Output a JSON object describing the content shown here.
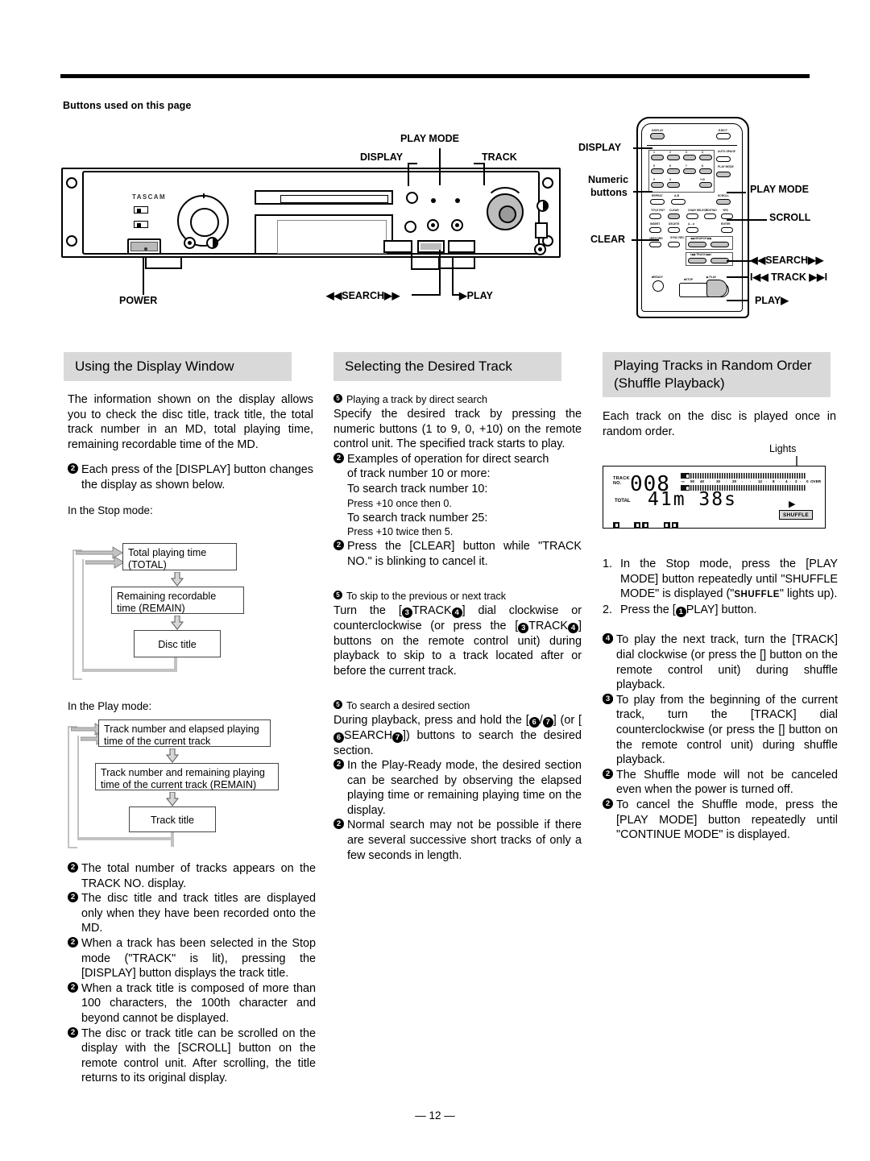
{
  "header": {
    "buttons_used": "Buttons used on this page"
  },
  "deck_figure": {
    "brand": "TASCAM",
    "callouts": {
      "play_mode": "PLAY MODE",
      "display": "DISPLAY",
      "track": "TRACK",
      "power": "POWER",
      "search": "◀◀SEARCH▶▶",
      "play": "▶PLAY"
    }
  },
  "remote_figure": {
    "callouts": {
      "display": "DISPLAY",
      "numeric_buttons_line1": "Numeric",
      "numeric_buttons_line2": "buttons",
      "clear": "CLEAR",
      "play_mode": "PLAY MODE",
      "scroll": "SCROLL",
      "search": "◀◀SEARCH▶▶",
      "track": "I◀◀ TRACK ▶▶I",
      "play": "PLAY▶"
    },
    "keys": {
      "display": "DISPLAY",
      "eject": "EJECT",
      "n1": "1",
      "n2": "2",
      "n3": "3",
      "n4": "4",
      "n5": "5",
      "n6": "6",
      "n7": "7",
      "n8": "8",
      "n9": "9",
      "n0": "0",
      "plus10": "+10",
      "auto_space": "AUTO SPACE",
      "play_mode": "PLAY MODE",
      "repeat": "REPEAT",
      "ab": "A-B",
      "scroll": "SCROLL",
      "title_ent": "TITLE ENT",
      "clear": "CLEAR",
      "char_select": "CHAR SELECT",
      "edit_no": "EDIT/NO",
      "yes": "YES",
      "insert": "INSERT",
      "delete": "DELETE",
      "case": "A↔a",
      "enter": "ENTER",
      "record": "●RECORD",
      "sync_rec": "SYNC REC",
      "search_grp": "◀◀ SEARCH ▶▶",
      "track_grp": "I◀◀ TRACK ▶▶I",
      "ready": "■READY",
      "stop": "■STOP",
      "play": "▶ PLAY"
    }
  },
  "col_left": {
    "heading": "Using the Display Window",
    "intro": "The information shown on the display allows you to check the disc title, track title, the total track number in an MD, total playing time, remaining recordable time of the MD.",
    "note_display": "Each press of the [DISPLAY] button changes the display as shown below.",
    "stop_mode_label": "In the Stop mode:",
    "stop_flow": [
      "Total playing time (TOTAL)",
      "Remaining recordable time (REMAIN)",
      "Disc title"
    ],
    "stop_flow_lines": {
      "b1l1": "Total playing time",
      "b1l2": "(TOTAL)",
      "b2l1": "Remaining recordable",
      "b2l2": "time (REMAIN)",
      "b3l1": "Disc title"
    },
    "play_mode_label": "In the Play mode:",
    "play_flow_lines": {
      "b1l1": "Track number and elapsed playing",
      "b1l2": "time of the current track",
      "b2l1": "Track number and remaining playing",
      "b2l2": "time of the current track (REMAIN)",
      "b3l1": "Track title"
    },
    "notes": [
      "The total number of tracks appears on the TRACK NO. display.",
      "The disc title and track titles are displayed only when they have been recorded onto the MD.",
      "When a track has been selected in the Stop mode (\"TRACK\" is lit), pressing the [DISPLAY] button displays the track title.",
      "When a track title is composed of more than 100 characters, the 100th character and beyond cannot be displayed.",
      "The disc or track title can be scrolled on the display with the [SCROLL] button on the remote control unit. After scrolling, the title returns to its original display."
    ]
  },
  "col_mid": {
    "heading": "Selecting the Desired Track",
    "sub1": "Playing a track by direct search",
    "para1": "Specify the desired track by pressing the numeric buttons (1 to 9, 0, +10) on the remote control unit. The specified track starts to play.",
    "note1_l1": "Examples of operation for direct search",
    "note1_l2": "of track number 10 or more:",
    "note1_l3": "To search track number 10:",
    "note1_l4": "Press +10 once then 0.",
    "note1_l5": "To search track number 25:",
    "note1_l6": "Press +10 twice then 5.",
    "note2": "Press the [CLEAR] button while \"TRACK NO.\" is blinking to cancel it.",
    "sub2": "To skip to the previous or next track",
    "para2_a": "Turn the [",
    "para2_b": "TRACK",
    "para2_c": "] dial clockwise or counterclockwise (or press the [",
    "para2_d": "TRACK",
    "para2_e": "] buttons on the remote control unit) during playback to skip to a track located after or before the current track.",
    "sub3": "To search a desired section",
    "para3_a": "During playback, press and hold the [",
    "para3_b": "/",
    "para3_c": "] (or [",
    "para3_d": "SEARCH",
    "para3_e": "]) buttons to search the desired section.",
    "note3": "In the Play-Ready mode, the desired section can be searched by observing the elapsed playing time or remaining playing time on the display.",
    "note4": "Normal search may not be possible if there are several successive short tracks of only a few seconds in length."
  },
  "col_right": {
    "heading_l1": "Playing Tracks in Random Order",
    "heading_l2": "(Shuffle Playback)",
    "intro": "Each track on the disc is played once in random order.",
    "lights_label": "Lights",
    "lcd": {
      "track_l1": "TRACK",
      "track_l2": "NO.",
      "track_number": "008",
      "total_label": "TOTAL",
      "time": "41m  38s",
      "shuffle": "SHUFFLE",
      "play_symbol": "▶",
      "scale": [
        "-∞",
        "50",
        "40",
        "·",
        "30",
        "·",
        "20",
        "·",
        "12",
        "·",
        "8",
        "·",
        "4",
        "·",
        "2",
        "·",
        "0",
        "OVER"
      ]
    },
    "steps": [
      {
        "num": "1.",
        "text_a": "In the Stop mode, press the [PLAY MODE] button repeatedly until \"SHUFFLE MODE\" is displayed (\"",
        "inline": "SHUFFLE",
        "text_b": "\" lights up)."
      },
      {
        "num": "2.",
        "text_a": "Press the [",
        "text_b": "PLAY] button."
      }
    ],
    "notes": [
      {
        "a": "To play the next track, turn the [",
        "b": "TRACK",
        "c": "] dial clockwise (or press the [",
        "d": "] button on the remote control unit) during shuffle playback."
      },
      {
        "a": "To play from the beginning of the current track, turn the [",
        "b": "TRACK",
        "c": "] dial counterclockwise (or press the [",
        "d": "] button on the remote control unit) during shuffle playback."
      }
    ],
    "note3": "The Shuffle mode will not be canceled even when the power is turned off.",
    "note4": "To cancel the Shuffle mode, press the [PLAY MODE] button repeatedly until \"CONTINUE MODE\" is displayed."
  },
  "footer": {
    "page": "— 12 —"
  },
  "bullets": {
    "note": "2",
    "step": "5",
    "b1": "1",
    "b3": "3",
    "b4": "4",
    "b6": "6",
    "b7": "7"
  }
}
